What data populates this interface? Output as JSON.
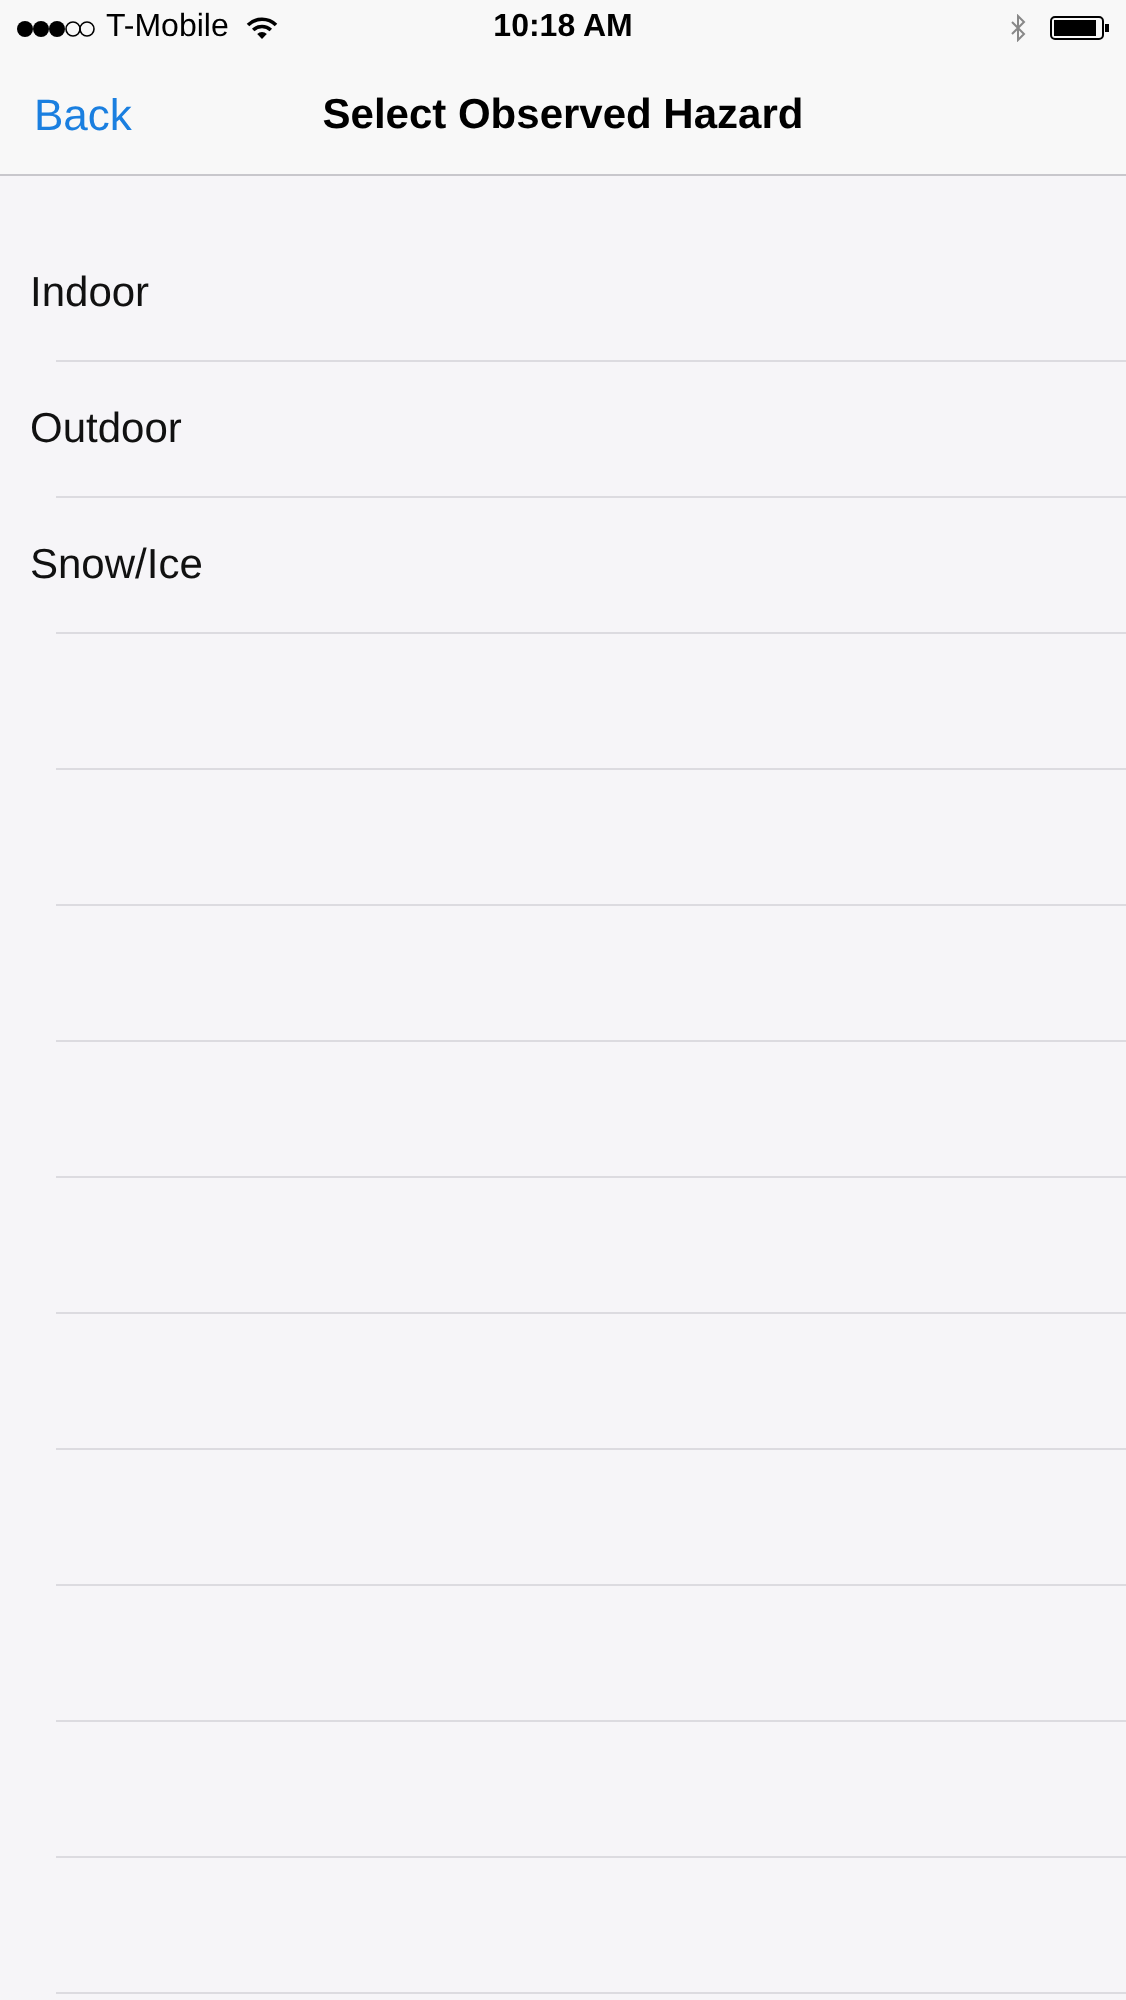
{
  "status_bar": {
    "carrier": "T-Mobile",
    "time": "10:18 AM"
  },
  "nav_bar": {
    "back": "Back",
    "title": "Select Observed Hazard"
  },
  "items": [
    {
      "label": "Indoor"
    },
    {
      "label": "Outdoor"
    },
    {
      "label": "Snow/Ice"
    }
  ]
}
